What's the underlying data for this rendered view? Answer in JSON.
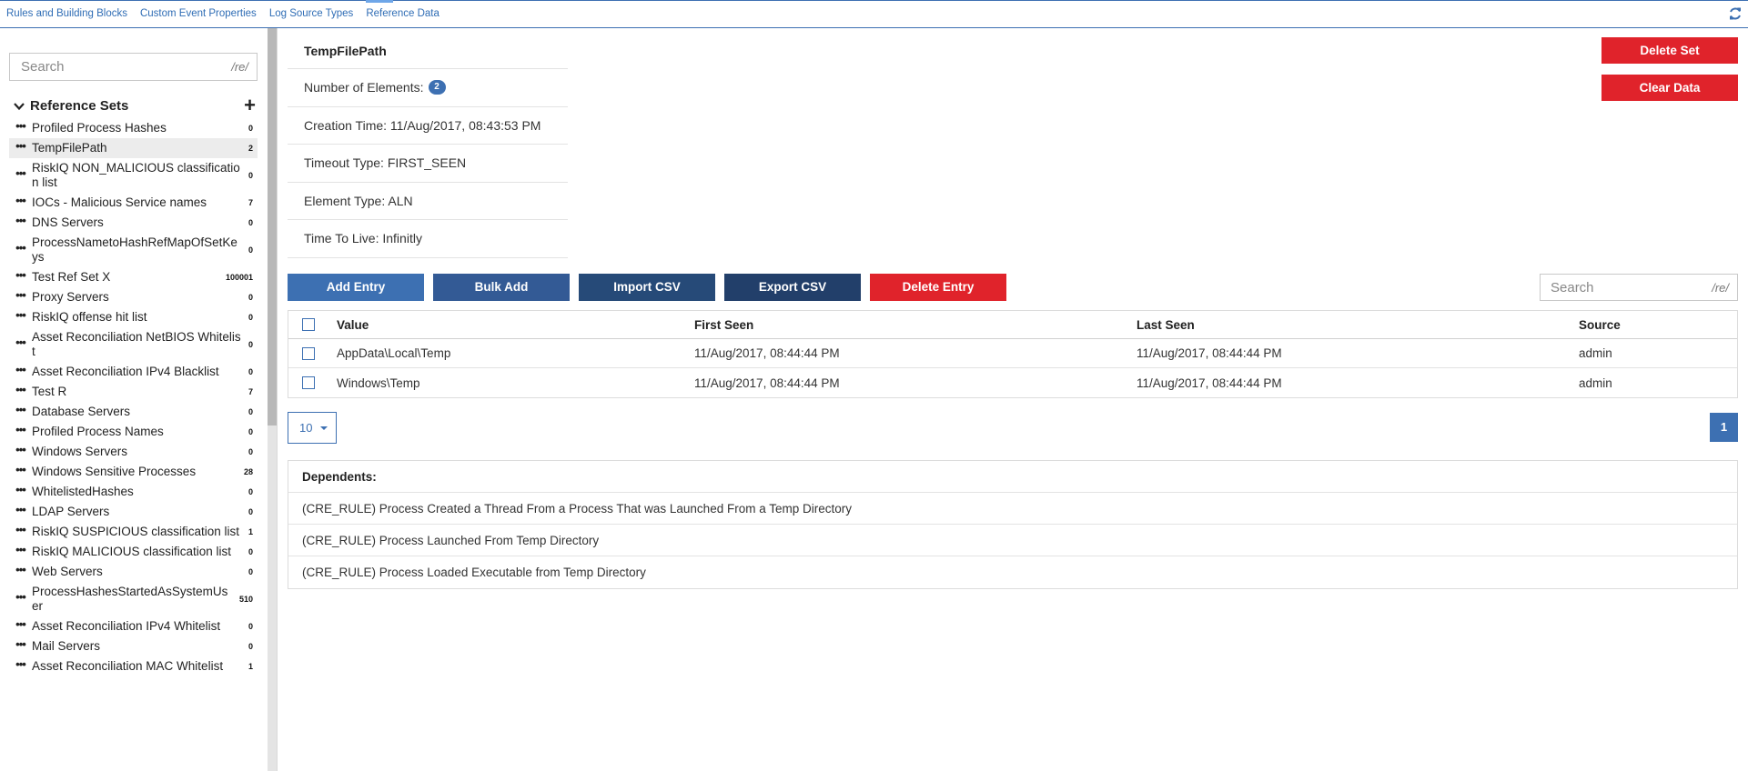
{
  "tabs": [
    {
      "label": "Rules and Building Blocks"
    },
    {
      "label": "Custom Event Properties"
    },
    {
      "label": "Log Source Types"
    },
    {
      "label": "Reference Data"
    }
  ],
  "active_tab": "Reference Data",
  "sidebar": {
    "search": {
      "placeholder": "Search",
      "regex_tag": "/re/"
    },
    "section_title": "Reference Sets",
    "items": [
      {
        "name": "Profiled Process Hashes",
        "count": "0"
      },
      {
        "name": "TempFilePath",
        "count": "2",
        "selected": true
      },
      {
        "name": "RiskIQ NON_MALICIOUS classification list",
        "count": "0"
      },
      {
        "name": "IOCs - Malicious Service names",
        "count": "7"
      },
      {
        "name": "DNS Servers",
        "count": "0"
      },
      {
        "name": "ProcessNametoHashRefMapOfSetKeys",
        "count": "0"
      },
      {
        "name": "Test Ref Set X",
        "count": "100001"
      },
      {
        "name": "Proxy Servers",
        "count": "0"
      },
      {
        "name": "RiskIQ offense hit list",
        "count": "0"
      },
      {
        "name": "Asset Reconciliation NetBIOS Whitelist",
        "count": "0"
      },
      {
        "name": "Asset Reconciliation IPv4 Blacklist",
        "count": "0"
      },
      {
        "name": "Test R",
        "count": "7"
      },
      {
        "name": "Database Servers",
        "count": "0"
      },
      {
        "name": "Profiled Process Names",
        "count": "0"
      },
      {
        "name": "Windows Servers",
        "count": "0"
      },
      {
        "name": "Windows Sensitive Processes",
        "count": "28"
      },
      {
        "name": "WhitelistedHashes",
        "count": "0"
      },
      {
        "name": "LDAP Servers",
        "count": "0"
      },
      {
        "name": "RiskIQ SUSPICIOUS classification list",
        "count": "1"
      },
      {
        "name": "RiskIQ MALICIOUS classification list",
        "count": "0"
      },
      {
        "name": "Web Servers",
        "count": "0"
      },
      {
        "name": "ProcessHashesStartedAsSystemUser",
        "count": "510"
      },
      {
        "name": "Asset Reconciliation IPv4 Whitelist",
        "count": "0"
      },
      {
        "name": "Mail Servers",
        "count": "0"
      },
      {
        "name": "Asset Reconciliation MAC Whitelist",
        "count": "1"
      }
    ]
  },
  "details": {
    "title": "TempFilePath",
    "elements_label": "Number of Elements:",
    "elements_count": "2",
    "creation_time": "Creation Time: 11/Aug/2017, 08:43:53 PM",
    "timeout_type": "Timeout Type: FIRST_SEEN",
    "element_type": "Element Type: ALN",
    "time_to_live": "Time To Live: Infinitly"
  },
  "buttons": {
    "delete_set": "Delete Set",
    "clear_data": "Clear Data",
    "add_entry": "Add Entry",
    "bulk_add": "Bulk Add",
    "import_csv": "Import CSV",
    "export_csv": "Export CSV",
    "delete_entry": "Delete Entry"
  },
  "table_search": {
    "placeholder": "Search",
    "regex_tag": "/re/"
  },
  "table": {
    "headers": {
      "value": "Value",
      "first_seen": "First Seen",
      "last_seen": "Last Seen",
      "source": "Source"
    },
    "rows": [
      {
        "value": "AppData\\Local\\Temp",
        "first_seen": "11/Aug/2017, 08:44:44 PM",
        "last_seen": "11/Aug/2017, 08:44:44 PM",
        "source": "admin"
      },
      {
        "value": "Windows\\Temp",
        "first_seen": "11/Aug/2017, 08:44:44 PM",
        "last_seen": "11/Aug/2017, 08:44:44 PM",
        "source": "admin"
      }
    ]
  },
  "pagination": {
    "page_size": "10",
    "current_page": "1"
  },
  "dependents": {
    "title": "Dependents:",
    "items": [
      "(CRE_RULE) Process Created a Thread From a Process That was Launched From a Temp Directory",
      "(CRE_RULE) Process Launched From Temp Directory",
      "(CRE_RULE) Process Loaded Executable from Temp Directory"
    ]
  },
  "colors": {
    "accent": "#3d70b2",
    "danger": "#e0232b",
    "dark_blue": "#223f6a"
  },
  "icons": {
    "refresh": "refresh-icon",
    "collapse": "chevron-down-icon",
    "add": "plus-icon",
    "item_menu": "ellipsis-icon"
  }
}
